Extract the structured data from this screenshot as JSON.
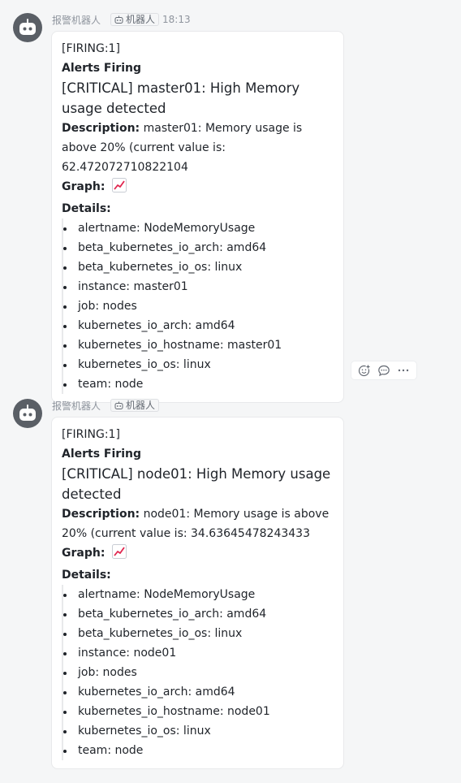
{
  "messages": [
    {
      "sender": "报警机器人",
      "tag": "机器人",
      "time": "18:13",
      "firing": "[FIRING:1]",
      "alerts_title": "Alerts Firing",
      "headline": "[CRITICAL] master01: High Memory usage detected",
      "description_label": "Description:",
      "description": "master01: Memory usage is above 20% (current value is: 62.472072710822104",
      "graph_label": "Graph:",
      "graph_icon": "chart-increasing-emoji",
      "details_label": "Details:",
      "details": [
        "alertname: NodeMemoryUsage",
        "beta_kubernetes_io_arch: amd64",
        "beta_kubernetes_io_os: linux",
        "instance: master01",
        "job: nodes",
        "kubernetes_io_arch: amd64",
        "kubernetes_io_hostname: master01",
        "kubernetes_io_os: linux",
        "team: node"
      ]
    },
    {
      "sender": "报警机器人",
      "tag": "机器人",
      "time": "",
      "firing": "[FIRING:1]",
      "alerts_title": "Alerts Firing",
      "headline": "[CRITICAL] node01: High Memory usage detected",
      "description_label": "Description:",
      "description": "node01: Memory usage is above 20% (current value is: 34.63645478243433",
      "graph_label": "Graph:",
      "graph_icon": "chart-increasing-emoji",
      "details_label": "Details:",
      "details": [
        "alertname: NodeMemoryUsage",
        "beta_kubernetes_io_arch: amd64",
        "beta_kubernetes_io_os: linux",
        "instance: node01",
        "job: nodes",
        "kubernetes_io_arch: amd64",
        "kubernetes_io_hostname: node01",
        "kubernetes_io_os: linux",
        "team: node"
      ]
    }
  ],
  "message_actions": [
    "add-reaction-icon",
    "reply-icon",
    "more-icon"
  ],
  "colors": {
    "background": "#f5f6f7",
    "card": "#ffffff",
    "meta": "#8f959e",
    "avatar": "#5a5f66"
  }
}
